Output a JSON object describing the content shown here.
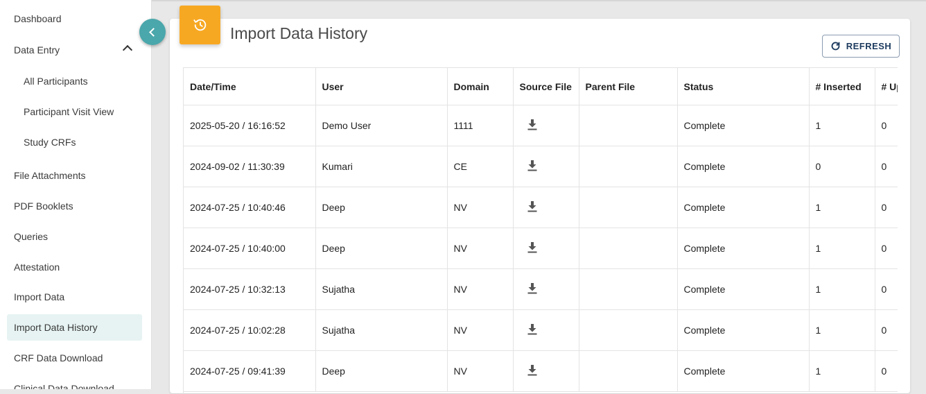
{
  "sidebar": {
    "items": [
      {
        "label": "Dashboard"
      },
      {
        "label": "Data Entry"
      },
      {
        "label": "All Participants"
      },
      {
        "label": "Participant Visit View"
      },
      {
        "label": "Study CRFs"
      },
      {
        "label": "File Attachments"
      },
      {
        "label": "PDF Booklets"
      },
      {
        "label": "Queries"
      },
      {
        "label": "Attestation"
      },
      {
        "label": "Import Data"
      },
      {
        "label": "Import Data History"
      },
      {
        "label": "CRF Data Download"
      },
      {
        "label": "Clinical Data Download"
      }
    ],
    "active_item": "Import Data History"
  },
  "header": {
    "title": "Import Data History",
    "refresh_label": "REFRESH",
    "title_icon": "history-icon",
    "accent_color": "#f7a823"
  },
  "table": {
    "columns": [
      "Date/Time",
      "User",
      "Domain",
      "Source File",
      "Parent File",
      "Status",
      "# Inserted",
      "# Up"
    ],
    "rows": [
      {
        "datetime": "2025-05-20 / 16:16:52",
        "user": "Demo User",
        "domain": "1111",
        "parent": "",
        "status": "Complete",
        "inserted": "1",
        "updated": "0"
      },
      {
        "datetime": "2024-09-02 / 11:30:39",
        "user": "Kumari",
        "domain": "CE",
        "parent": "",
        "status": "Complete",
        "inserted": "0",
        "updated": "0"
      },
      {
        "datetime": "2024-07-25 / 10:40:46",
        "user": "Deep",
        "domain": "NV",
        "parent": "",
        "status": "Complete",
        "inserted": "1",
        "updated": "0"
      },
      {
        "datetime": "2024-07-25 / 10:40:00",
        "user": "Deep",
        "domain": "NV",
        "parent": "",
        "status": "Complete",
        "inserted": "1",
        "updated": "0"
      },
      {
        "datetime": "2024-07-25 / 10:32:13",
        "user": "Sujatha",
        "domain": "NV",
        "parent": "",
        "status": "Complete",
        "inserted": "1",
        "updated": "0"
      },
      {
        "datetime": "2024-07-25 / 10:02:28",
        "user": "Sujatha",
        "domain": "NV",
        "parent": "",
        "status": "Complete",
        "inserted": "1",
        "updated": "0"
      },
      {
        "datetime": "2024-07-25 / 09:41:39",
        "user": "Deep",
        "domain": "NV",
        "parent": "",
        "status": "Complete",
        "inserted": "1",
        "updated": "0"
      }
    ]
  },
  "colors": {
    "sidebar_active_bg": "#e6f3f2",
    "collapse_button": "#4aa7ab"
  }
}
